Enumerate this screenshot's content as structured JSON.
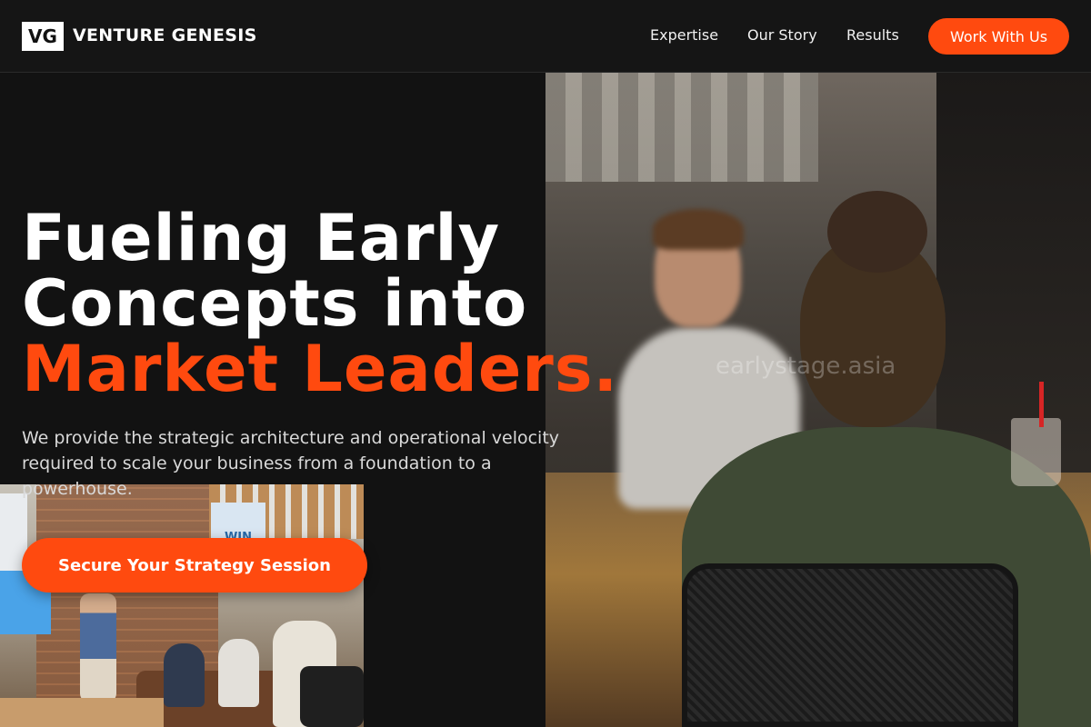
{
  "header": {
    "logo_mark": "VG",
    "brand_name": "VENTURE GENESIS",
    "nav": [
      "Expertise",
      "Our Story",
      "Results"
    ],
    "cta_label": "Work With Us"
  },
  "hero": {
    "title_line1": "Fueling Early",
    "title_line2": "Concepts into",
    "title_accent": "Market Leaders.",
    "description": "We provide the strategic architecture and operational velocity required to scale your business from a foundation to a powerhouse.",
    "cta_label": "Secure Your Strategy Session"
  },
  "images": {
    "watermark": "earlystage.asia",
    "office_sign": "WIN"
  },
  "colors": {
    "accent": "#ff4a0f",
    "background": "#121212",
    "text": "#ffffff"
  }
}
